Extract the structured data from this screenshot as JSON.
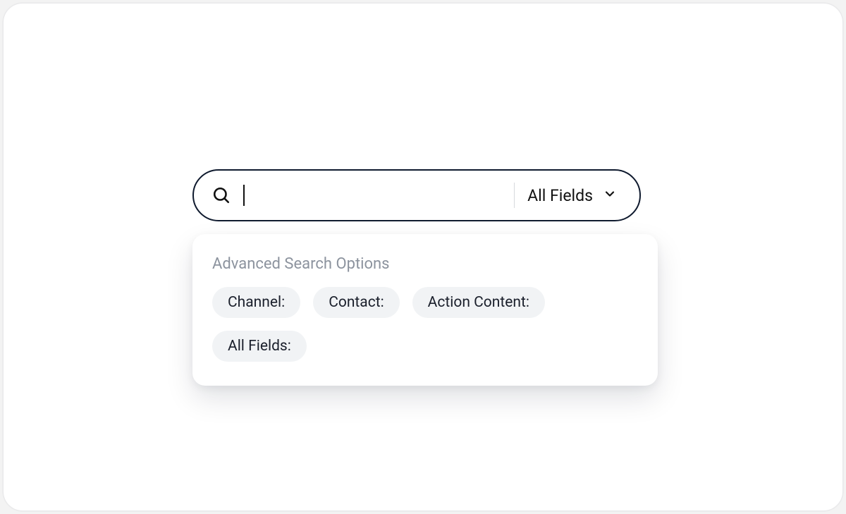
{
  "search": {
    "scope_label": "All Fields"
  },
  "advanced": {
    "title": "Advanced Search Options",
    "options": [
      "Channel:",
      "Contact:",
      "Action Content:",
      "All Fields:"
    ]
  }
}
